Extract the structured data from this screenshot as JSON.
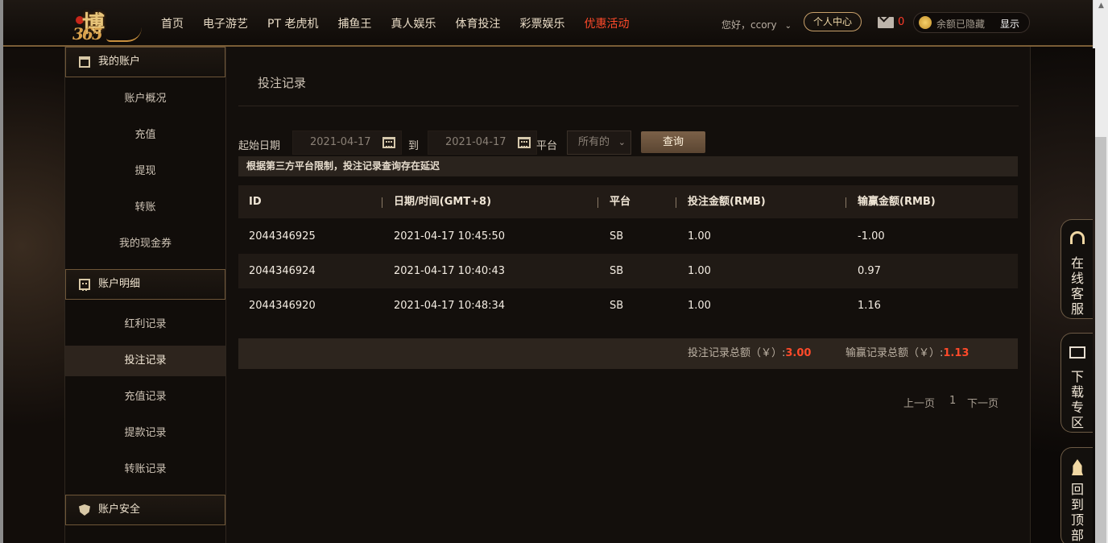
{
  "header": {
    "logo_text": "博",
    "logo_number": "365",
    "nav": [
      {
        "label": "首页",
        "name": "nav-home"
      },
      {
        "label": "电子游艺",
        "name": "nav-egames"
      },
      {
        "label": "PT 老虎机",
        "name": "nav-pt-slots"
      },
      {
        "label": "捕鱼王",
        "name": "nav-fishing"
      },
      {
        "label": "真人娱乐",
        "name": "nav-live-casino"
      },
      {
        "label": "体育投注",
        "name": "nav-sports"
      },
      {
        "label": "彩票娱乐",
        "name": "nav-lottery"
      },
      {
        "label": "优惠活动",
        "name": "nav-promotions"
      }
    ],
    "greeting": "您好，ccory",
    "personal_center": "个人中心",
    "mail_count": "0",
    "balance_hidden": "余额已隐藏",
    "show_label": "显示"
  },
  "sidebar": {
    "account_head": "我的账户",
    "account_items": [
      "账户概况",
      "充值",
      "提现",
      "转账",
      "我的现金券"
    ],
    "detail_head": "账户明细",
    "detail_items": [
      "红利记录",
      "投注记录",
      "充值记录",
      "提款记录",
      "转账记录"
    ],
    "active_item": "投注记录",
    "security_head": "账户安全"
  },
  "main": {
    "title": "投注记录",
    "filter": {
      "start_label": "起始日期",
      "start_date": "2021-04-17",
      "to_label": "到",
      "end_date": "2021-04-17",
      "platform_label": "平台",
      "platform_selected": "所有的",
      "query_label": "查询"
    },
    "notice": "根据第三方平台限制，投注记录查询存在延迟",
    "table": {
      "headers": [
        "ID",
        "日期/时间(GMT+8)",
        "平台",
        "投注金额(RMB)",
        "输赢金额(RMB)"
      ],
      "rows": [
        [
          "2044346925",
          "2021-04-17 10:45:50",
          "SB",
          "1.00",
          "-1.00"
        ],
        [
          "2044346924",
          "2021-04-17 10:40:43",
          "SB",
          "1.00",
          "0.97"
        ],
        [
          "2044346920",
          "2021-04-17 10:48:34",
          "SB",
          "1.00",
          "1.16"
        ]
      ]
    },
    "summary": {
      "bet_total_label": "投注记录总额（￥）:",
      "bet_total_value": "3.00",
      "win_total_label": "输赢记录总额（￥）:",
      "win_total_value": "1.13"
    },
    "pagination": {
      "prev": "上一页",
      "current": "1",
      "next": "下一页"
    }
  },
  "float": {
    "service": [
      "在",
      "线",
      "客",
      "服"
    ],
    "download": [
      "下",
      "载",
      "专",
      "区"
    ],
    "top": [
      "回",
      "到",
      "顶",
      "部"
    ]
  },
  "colors": {
    "accent_gold": "#c8a06a",
    "highlight_red": "#ff4a2a",
    "background": "#0c0907"
  }
}
